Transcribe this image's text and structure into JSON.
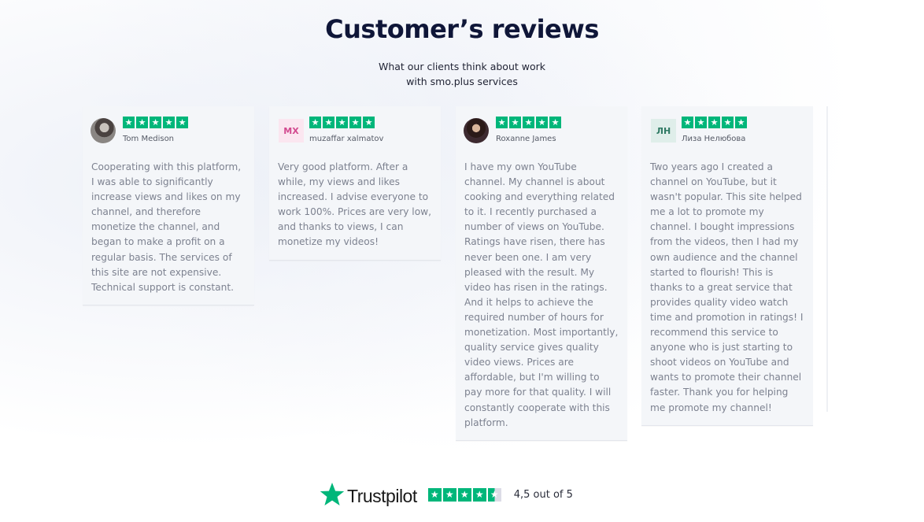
{
  "header": {
    "title": "Customer’s reviews",
    "subtitle_line1": "What our clients think about work",
    "subtitle_line2": "with smo.plus services"
  },
  "star_glyph": "★",
  "reviews": [
    {
      "name": "Tom Medison",
      "avatar": "photo",
      "rating": 5,
      "text": "Cooperating with this platform, I was able to significantly increase views and likes on my channel, and therefore monetize the channel, and began to make a profit on a regular basis. The services of this site are not expensive. Technical support is constant."
    },
    {
      "name": "muzaffar xalmatov",
      "avatar": "initials",
      "initials": "MX",
      "rating": 5,
      "text": "Very good platform. After a while, my views and likes increased. I advise everyone to work 100%. Prices are very low, and thanks to views, I can monetize my videos!"
    },
    {
      "name": "Roxanne James",
      "avatar": "photo",
      "rating": 5,
      "text": "I have my own YouTube channel. My channel is about cooking and everything related to it. I recently purchased a number of views on YouTube. Ratings have risen, there has never been one. I am very pleased with the result. My video has risen in the ratings. And it helps to achieve the required number of hours for monetization. Most importantly, quality service gives quality video views. Prices are affordable, but I'm willing to pay more for that quality. I will constantly cooperate with this platform."
    },
    {
      "name": "Лиза Нелюбова",
      "avatar": "initials",
      "initials": "ЛН",
      "rating": 5,
      "text": "Two years ago I created a channel on YouTube, but it wasn't popular. This site helped me a lot to promote my channel. I bought impressions from the videos, then I had my own audience and the channel started to flourish! This is thanks to a great service that provides quality video watch time and promotion in ratings! I recommend this service to anyone who is just starting to shoot videos on YouTube and wants to promote their channel faster. Thank you for helping me promote my channel!"
    }
  ],
  "trustpilot": {
    "brand": "Trustpilot",
    "score_text": "4,5 out of 5",
    "rating": 4.5,
    "color": "#00b67a"
  },
  "colors": {
    "title": "#0f1638",
    "card_bg": "#f4f6f9",
    "review_text": "#7d8290",
    "star_green": "#00b67a"
  }
}
